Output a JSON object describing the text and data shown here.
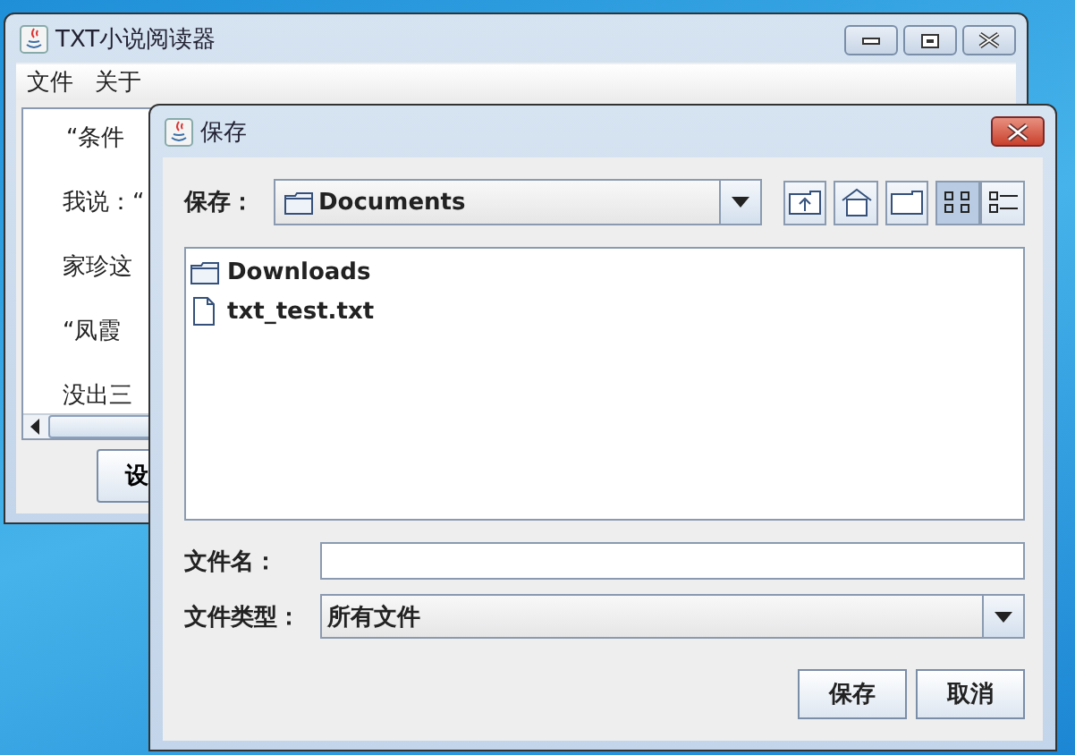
{
  "main_window": {
    "title": "TXT小说阅读器",
    "menu": [
      "文件",
      "关于"
    ],
    "text_lines": [
      "“条件",
      "我说：“",
      "家珍这",
      "“凤霞",
      "没出三"
    ],
    "button": "设"
  },
  "dialog": {
    "title": "保存",
    "save_in_label": "保存：",
    "save_in_value": "Documents",
    "view_modes": [
      {
        "kind": "list",
        "selected": true
      },
      {
        "kind": "details",
        "selected": false
      }
    ],
    "files": [
      {
        "name": "Downloads",
        "kind": "folder"
      },
      {
        "name": "txt_test.txt",
        "kind": "file"
      }
    ],
    "file_name_label": "文件名：",
    "file_type_label": "文件类型：",
    "file_type_value": "所有文件",
    "buttons": [
      "保存",
      "取消"
    ]
  }
}
